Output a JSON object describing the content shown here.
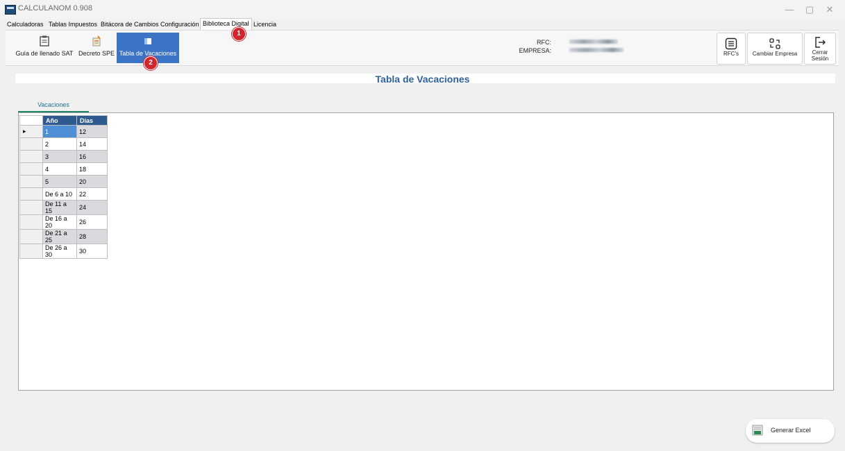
{
  "window": {
    "title": "CALCULANOM 0.908",
    "controls": {
      "minimize": "—",
      "maximize": "▢",
      "close": "✕"
    }
  },
  "menu_tabs": [
    {
      "label": "Calculadoras"
    },
    {
      "label": "Tablas Impuestos"
    },
    {
      "label": "Bitácora de Cambios"
    },
    {
      "label": "Configuración"
    },
    {
      "label": "Biblioteca Digital",
      "active": true
    },
    {
      "label": "Licencia"
    }
  ],
  "ribbon": {
    "buttons": [
      {
        "label": "Guía de llenado SAT",
        "icon": "clipboard-icon"
      },
      {
        "label": "Decreto SPE",
        "icon": "document-pen-icon"
      },
      {
        "label": "Tabla de Vacaciones",
        "icon": "table-icon",
        "selected": true
      }
    ],
    "rfc_label": "RFC:",
    "empresa_label": "EMPRESA:",
    "right_buttons": [
      {
        "label": "RFC's",
        "icon": "list-icon"
      },
      {
        "label": "Cambiar Empresa",
        "icon": "swap-icon"
      },
      {
        "label_line1": "Cerrar",
        "label_line2": "Sesión",
        "icon": "logout-icon"
      }
    ]
  },
  "annotations": {
    "badge1": "1",
    "badge2": "2",
    "color": "#d1262c"
  },
  "page": {
    "title": "Tabla de Vacaciones"
  },
  "inner_tab": {
    "label": "Vacaciones"
  },
  "grid": {
    "headers": [
      "Año",
      "Días"
    ],
    "rows": [
      {
        "anio": "1",
        "dias": "12"
      },
      {
        "anio": "2",
        "dias": "14"
      },
      {
        "anio": "3",
        "dias": "16"
      },
      {
        "anio": "4",
        "dias": "18"
      },
      {
        "anio": "5",
        "dias": "20"
      },
      {
        "anio": "De 6 a 10",
        "dias": "22"
      },
      {
        "anio": "De 11 a 15",
        "dias": "24"
      },
      {
        "anio": "De 16 a 20",
        "dias": "26"
      },
      {
        "anio": "De 21 a 25",
        "dias": "28"
      },
      {
        "anio": "De 26 a 30",
        "dias": "30"
      }
    ],
    "current_row_marker": "▸"
  },
  "footer": {
    "excel_button": "Generar Excel"
  },
  "colors": {
    "accent": "#3b74c4",
    "header": "#2f5a8f",
    "title": "#2e5f9e"
  }
}
